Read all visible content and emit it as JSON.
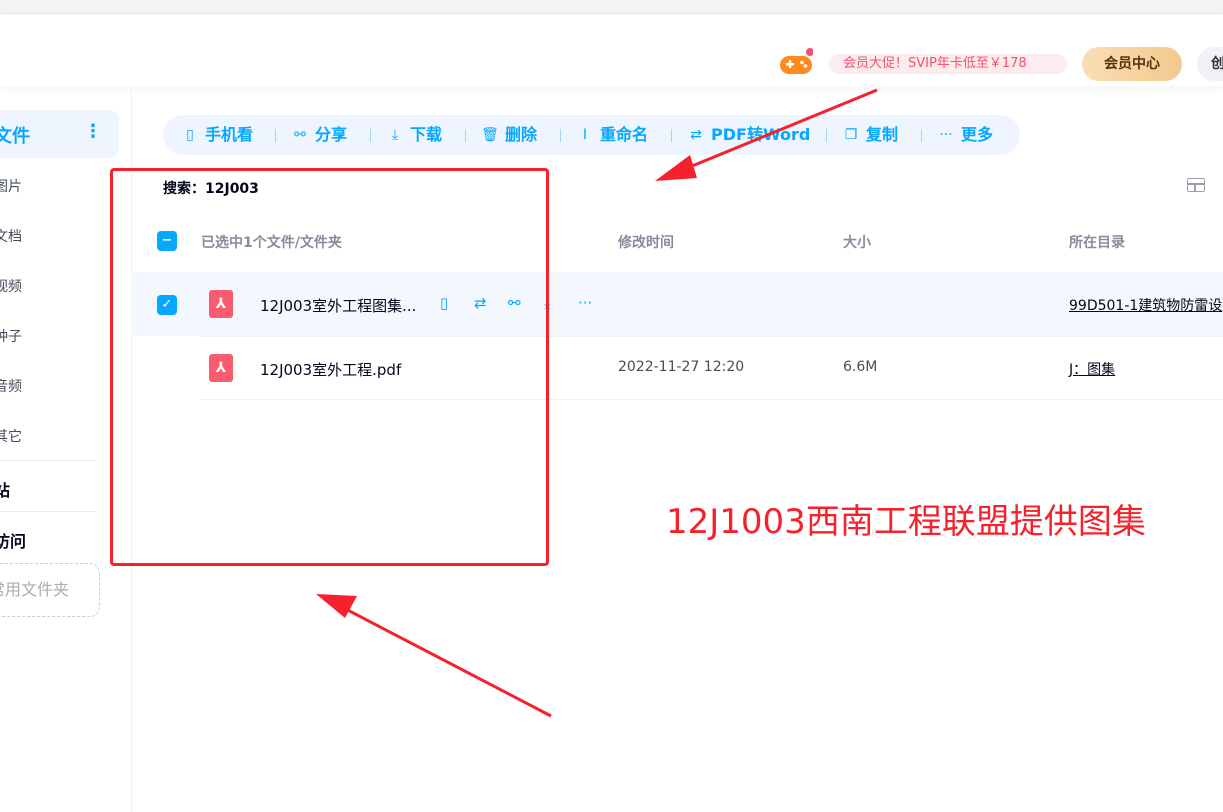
{
  "header": {
    "promo_text": "会员大促！SVIP年卡低至￥178",
    "vip_button": "会员中心",
    "create_button": "创"
  },
  "sidebar": {
    "active": {
      "label": "文件",
      "more": "⋮"
    },
    "items": [
      {
        "label": "图片"
      },
      {
        "label": "文档"
      },
      {
        "label": "视频"
      },
      {
        "label": "种子"
      },
      {
        "label": "音频"
      },
      {
        "label": "其它"
      }
    ],
    "sections": [
      {
        "label": "站"
      },
      {
        "label": "访问"
      }
    ],
    "add_folder": "常用文件夹"
  },
  "toolbar": {
    "items": [
      {
        "label": "手机看",
        "icon": "phone-icon"
      },
      {
        "label": "分享",
        "icon": "share-icon"
      },
      {
        "label": "下载",
        "icon": "download-icon"
      },
      {
        "label": "删除",
        "icon": "trash-icon"
      },
      {
        "label": "重命名",
        "icon": "rename-icon"
      },
      {
        "label": "PDF转Word",
        "icon": "convert-icon"
      },
      {
        "label": "复制",
        "icon": "copy-icon"
      },
      {
        "label": "更多",
        "icon": "more-icon"
      }
    ]
  },
  "search": {
    "label": "搜索：12J003"
  },
  "table": {
    "selected_summary": "已选中1个文件/文件夹",
    "columns": {
      "modified": "修改时间",
      "size": "大小",
      "directory": "所在目录"
    },
    "rows": [
      {
        "name": "12J003室外工程图集...",
        "modified": "",
        "size": "",
        "directory": "99D501-1建筑物防雷设",
        "selected": true
      },
      {
        "name": "12J003室外工程.pdf",
        "modified": "2022-11-27 12:20",
        "size": "6.6M",
        "directory": "J：图集",
        "selected": false
      }
    ]
  },
  "annotation": {
    "text": "12J1003西南工程联盟提供图集",
    "color": "#f5222d"
  },
  "colors": {
    "accent": "#06a7ff",
    "pdf": "#f85c6e",
    "annotation": "#f5222d"
  }
}
